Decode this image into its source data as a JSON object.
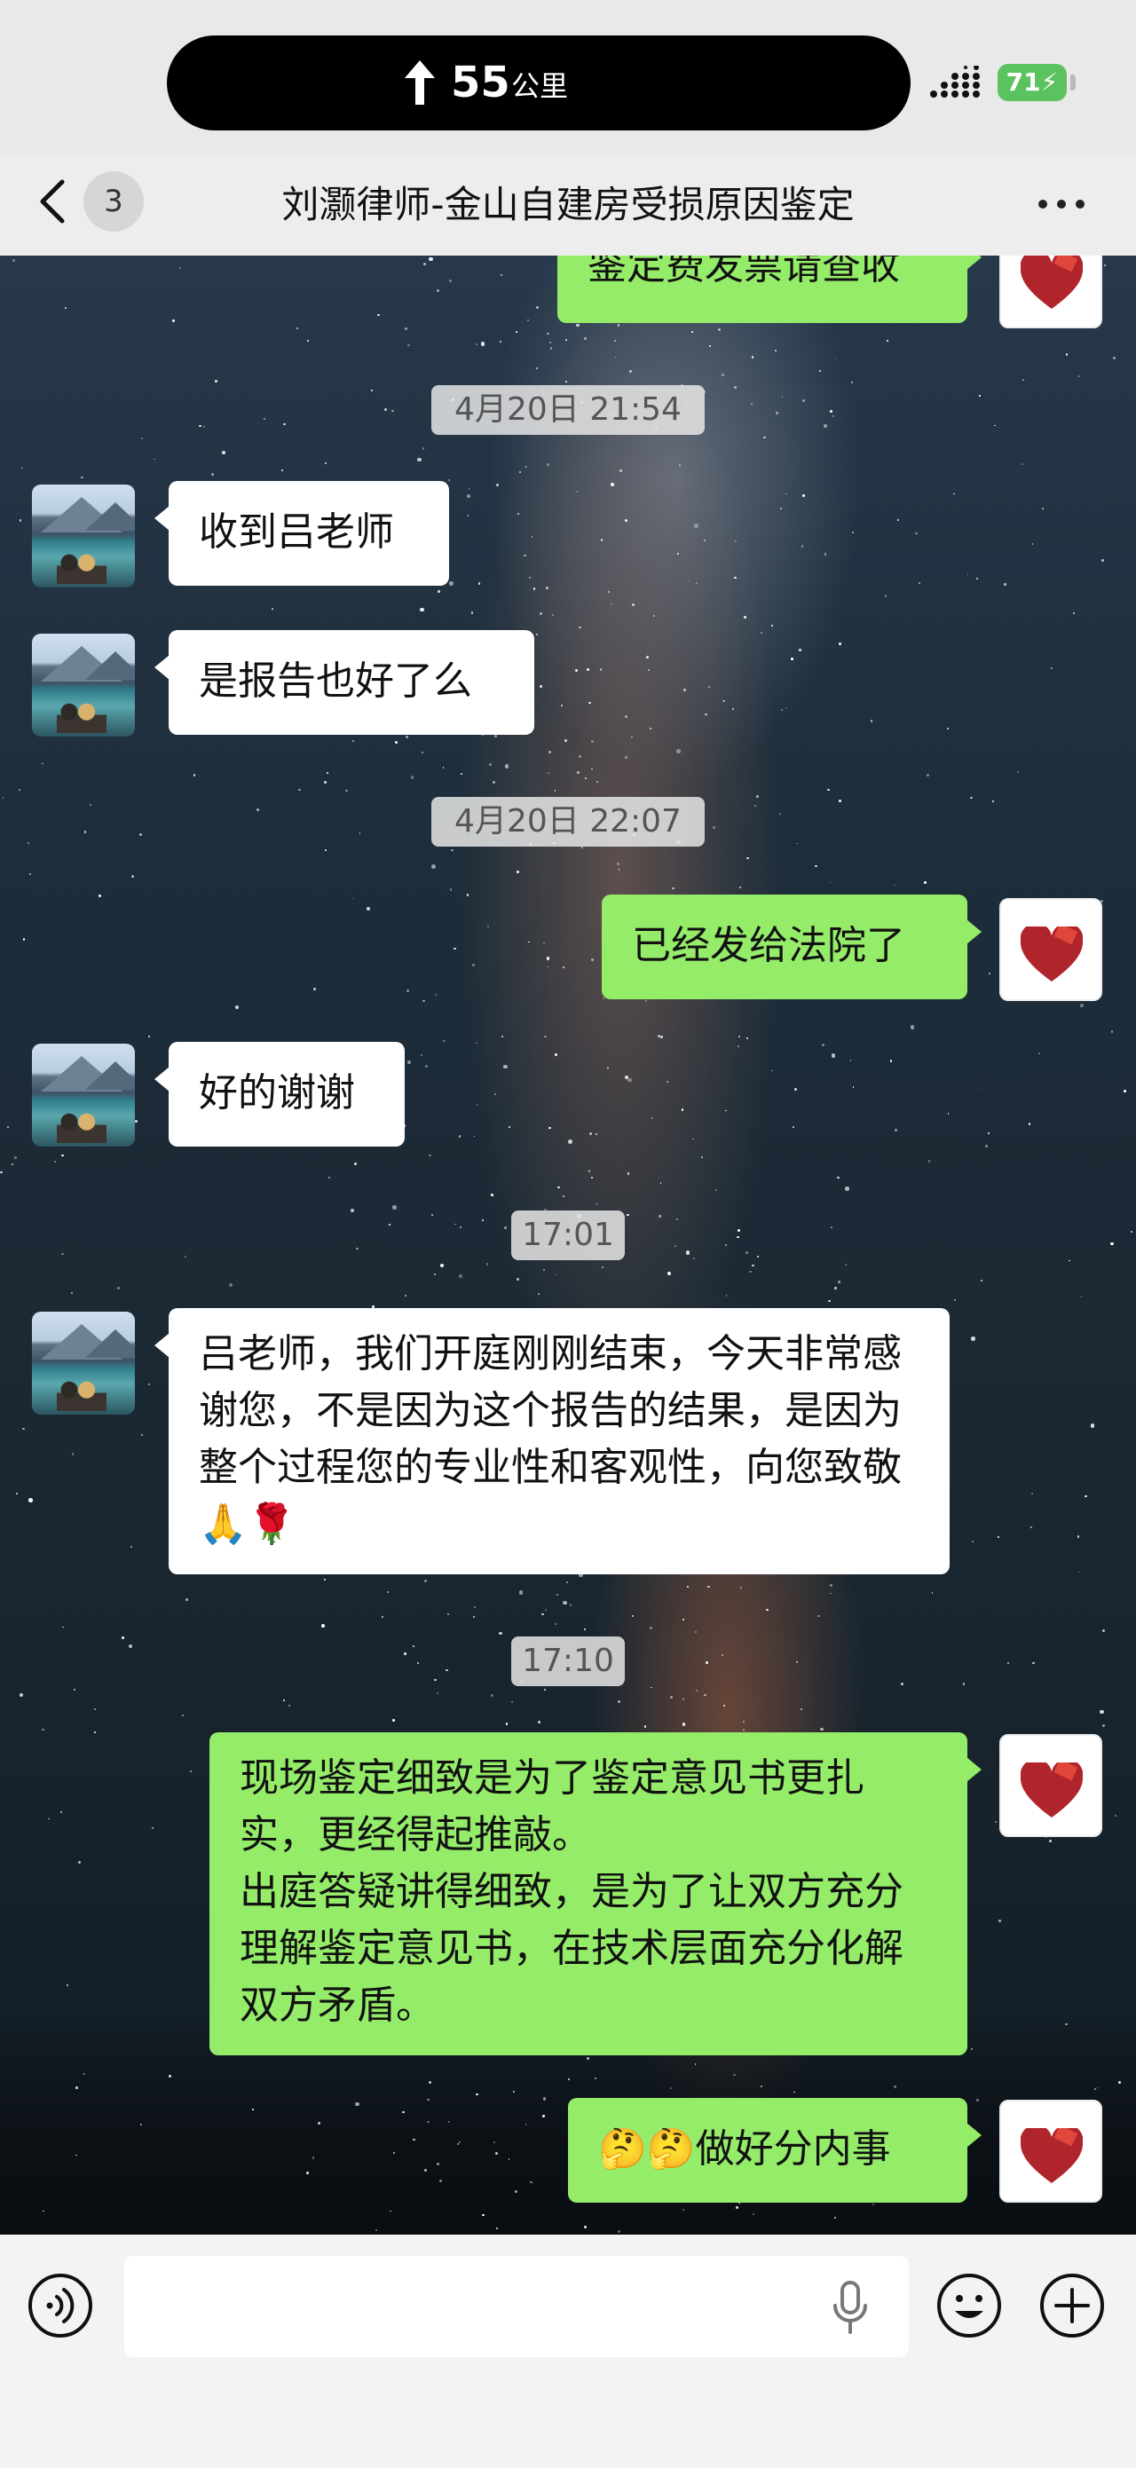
{
  "status_bar": {
    "navigation_distance": "55",
    "navigation_unit": "公里",
    "battery_level": "71"
  },
  "nav_bar": {
    "unread_count": "3",
    "title": "刘灏律师-金山自建房受损原因鉴定"
  },
  "messages": [
    {
      "type": "out",
      "text": "鉴定费发票请查收"
    },
    {
      "type": "timestamp",
      "text": "4月20日 21:54"
    },
    {
      "type": "in",
      "text": "收到吕老师"
    },
    {
      "type": "in",
      "text": "是报告也好了么"
    },
    {
      "type": "timestamp",
      "text": "4月20日 22:07"
    },
    {
      "type": "out",
      "text": "已经发给法院了"
    },
    {
      "type": "in",
      "text": "好的谢谢"
    },
    {
      "type": "timestamp",
      "text": "17:01"
    },
    {
      "type": "in",
      "text": "吕老师，我们开庭刚刚结束，今天非常感谢您，不是因为这个报告的结果，是因为整个过程您的专业性和客观性，向您致敬🙏🌹"
    },
    {
      "type": "timestamp",
      "text": "17:10"
    },
    {
      "type": "out",
      "text": "现场鉴定细致是为了鉴定意见书更扎实，更经得起推敲。\n出庭答疑讲得细致，是为了让双方充分理解鉴定意见书，在技术层面充分化解双方矛盾。"
    },
    {
      "type": "out",
      "text": "🤔🤔做好分内事"
    }
  ],
  "input": {
    "value": "",
    "placeholder": ""
  },
  "icons": {
    "back": "chevron-left-icon",
    "more": "more-dots-icon",
    "voice": "voice-icon",
    "mic": "microphone-icon",
    "emoji": "emoji-icon",
    "plus": "plus-icon"
  },
  "colors": {
    "outgoing_bubble": "#95ec69",
    "incoming_bubble": "#ffffff",
    "battery": "#5ac25f"
  }
}
